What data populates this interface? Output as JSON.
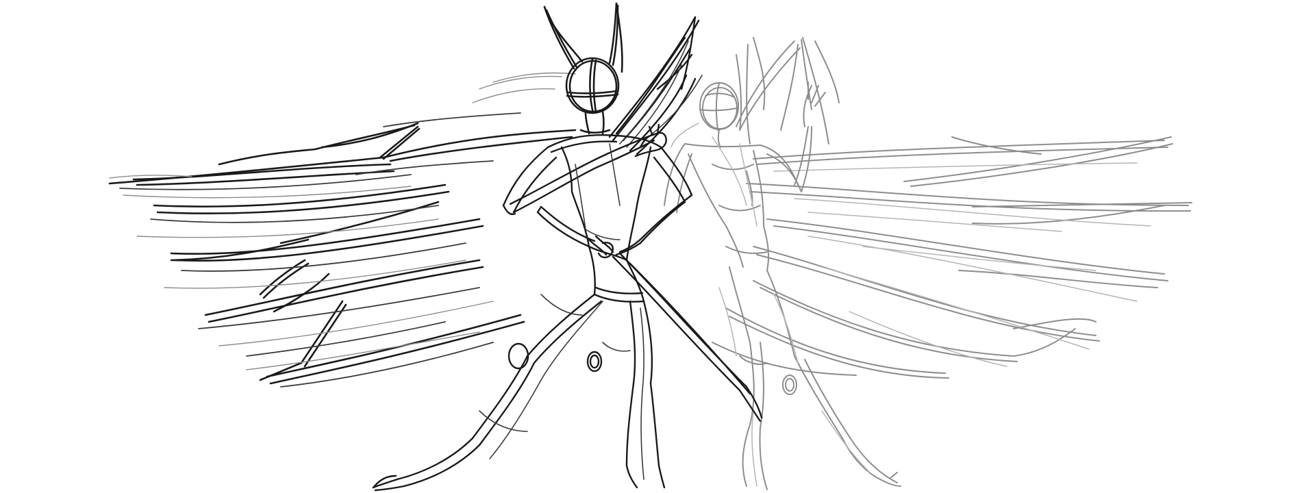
{
  "scene": {
    "background_color": "#ffffff",
    "front_stroke_color": "#1a1a1a",
    "back_stroke_color": "#8c8c8c"
  }
}
